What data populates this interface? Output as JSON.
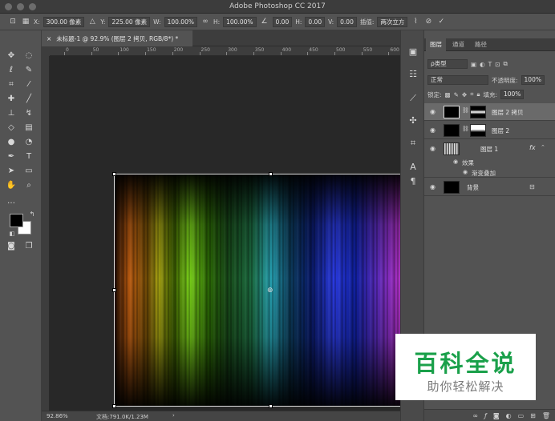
{
  "window": {
    "title": "Adobe Photoshop CC 2017"
  },
  "options_bar": {
    "x_label": "X:",
    "x_value": "300.00 像素",
    "y_label": "Y:",
    "y_value": "225.00 像素",
    "w_label": "W:",
    "w_value": "100.00%",
    "h_label": "H:",
    "h_value": "100.00%",
    "angle_value": "0.00",
    "hskew_label": "H:",
    "hskew_value": "0.00",
    "vskew_label": "V:",
    "vskew_value": "0.00",
    "interp_label": "插值:",
    "interp_value": "两次立方"
  },
  "document_tab": {
    "title": "未标题-1 @ 92.9% (图层 2 拷贝, RGB/8*) *",
    "close": "×"
  },
  "ruler": {
    "ticks": [
      "0",
      "50",
      "100",
      "150",
      "200",
      "250",
      "300",
      "350",
      "400",
      "450",
      "500",
      "550",
      "600"
    ]
  },
  "swatches": {
    "foreground": "#000000",
    "background": "#ffffff"
  },
  "status_bar": {
    "zoom": "92.86%",
    "doc": "文档:791.0K/1.23M",
    "arrow": "›"
  },
  "layers_panel": {
    "tabs": [
      "图层",
      "通道",
      "路径"
    ],
    "filter_label": "ρ类型",
    "blend_mode": "正常",
    "opacity_label": "不透明度:",
    "opacity_value": "100%",
    "lock_label": "锁定:",
    "fill_label": "填充:",
    "fill_value": "100%",
    "layers": [
      {
        "name": "图层 2 拷贝"
      },
      {
        "name": "图层 2"
      },
      {
        "name": "图层 1",
        "fx": "fx"
      },
      {
        "name": "背景"
      }
    ],
    "effects_label": "效果",
    "effect_item": "渐变叠加"
  },
  "watermark": {
    "title": "百科全说",
    "subtitle": "助你轻松解决"
  },
  "colors": {
    "accent_green": "#1aa04a",
    "panel_bg": "#535353",
    "workspace_bg": "#282828"
  }
}
